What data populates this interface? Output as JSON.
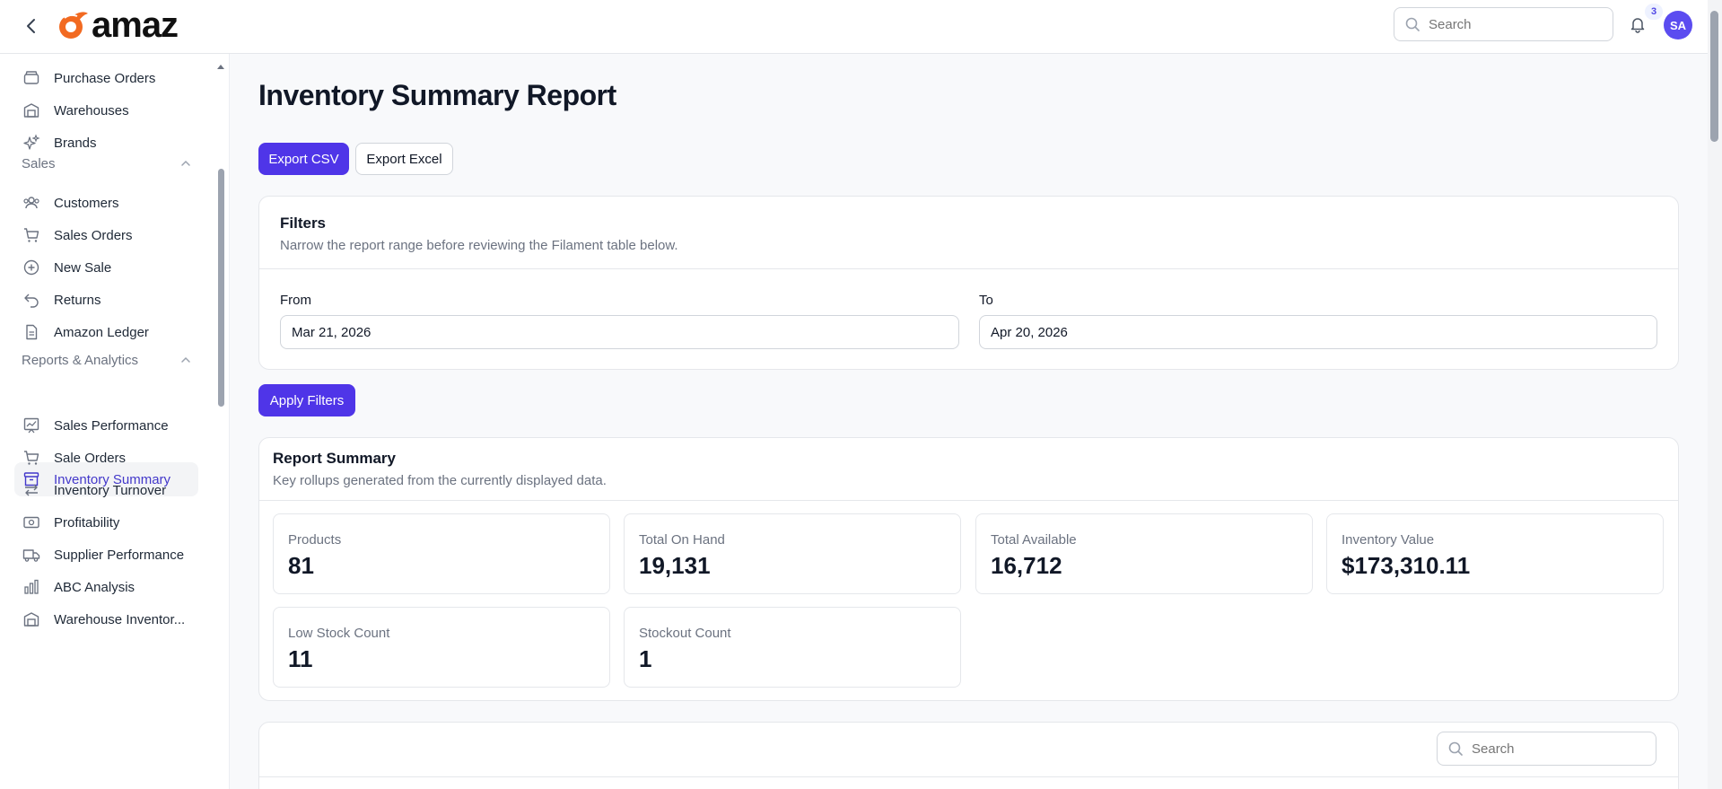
{
  "header": {
    "logo_text": "amaz",
    "search_placeholder": "Search",
    "notification_count": "3",
    "avatar_initials": "SA",
    "brand_color": "#5b4cf0"
  },
  "sidebar": {
    "items_top": [
      {
        "label": "Purchase Orders",
        "icon": "box-icon"
      },
      {
        "label": "Warehouses",
        "icon": "building-icon"
      },
      {
        "label": "Brands",
        "icon": "sparkles-icon"
      }
    ],
    "sales_group": {
      "label": "Sales",
      "items": [
        {
          "label": "Customers",
          "icon": "users-icon"
        },
        {
          "label": "Sales Orders",
          "icon": "cart-icon"
        },
        {
          "label": "New Sale",
          "icon": "plus-circle-icon"
        },
        {
          "label": "Returns",
          "icon": "return-arrow-icon"
        },
        {
          "label": "Amazon Ledger",
          "icon": "document-icon"
        }
      ]
    },
    "reports_group": {
      "label": "Reports & Analytics",
      "items": [
        {
          "label": "Inventory Summary",
          "icon": "archive-icon",
          "active": true
        },
        {
          "label": "Sales Performance",
          "icon": "chart-line-icon"
        },
        {
          "label": "Sale Orders",
          "icon": "cart-icon"
        },
        {
          "label": "Inventory Turnover",
          "icon": "arrows-exchange-icon"
        },
        {
          "label": "Profitability",
          "icon": "cash-icon"
        },
        {
          "label": "Supplier Performance",
          "icon": "truck-icon"
        },
        {
          "label": "ABC Analysis",
          "icon": "bar-chart-icon"
        },
        {
          "label": "Warehouse Inventor...",
          "icon": "building-icon"
        }
      ]
    }
  },
  "main": {
    "title": "Inventory Summary Report",
    "export_csv_label": "Export CSV",
    "export_excel_label": "Export Excel",
    "filters": {
      "title": "Filters",
      "description": "Narrow the report range before reviewing the Filament table below.",
      "from_label": "From",
      "from_value": "Mar 21, 2026",
      "to_label": "To",
      "to_value": "Apr 20, 2026"
    },
    "apply_filters_label": "Apply Filters",
    "summary": {
      "title": "Report Summary",
      "description": "Key rollups generated from the currently displayed data.",
      "stats": [
        {
          "label": "Products",
          "value": "81"
        },
        {
          "label": "Total On Hand",
          "value": "19,131"
        },
        {
          "label": "Total Available",
          "value": "16,712"
        },
        {
          "label": "Inventory Value",
          "value": "$173,310.11"
        },
        {
          "label": "Low Stock Count",
          "value": "11"
        },
        {
          "label": "Stockout Count",
          "value": "1"
        }
      ]
    },
    "table_search_placeholder": "Search"
  }
}
